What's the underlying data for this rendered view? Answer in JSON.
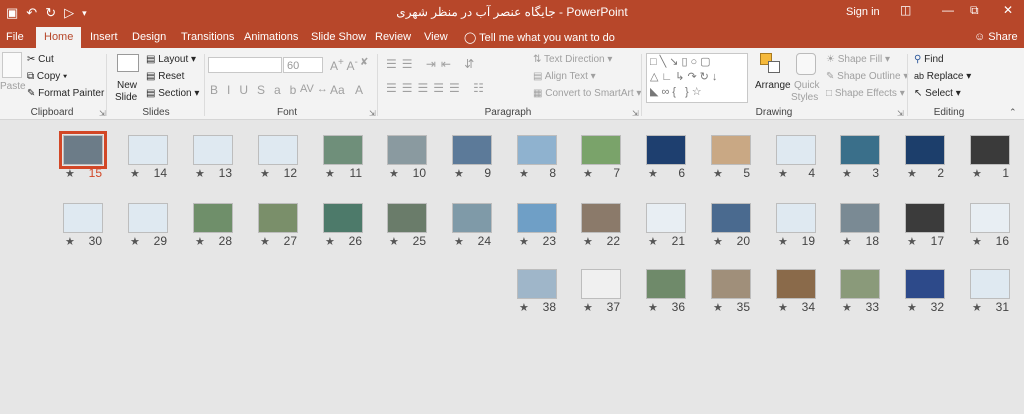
{
  "titlebar": {
    "title": "جایگاه عنصر آب در منظر شهری  -  PowerPoint",
    "sign_in": "Sign in",
    "minimize": "—"
  },
  "tabs": [
    "File",
    "Home",
    "Insert",
    "Design",
    "Transitions",
    "Animations",
    "Slide Show",
    "Review",
    "View"
  ],
  "tell_me": "Tell me what you want to do",
  "share": "Share",
  "ribbon": {
    "clipboard": {
      "paste": "Paste",
      "cut": "Cut",
      "copy": "Copy",
      "format_painter": "Format Painter",
      "label": "Clipboard"
    },
    "slides": {
      "new_slide_1": "New",
      "new_slide_2": "Slide",
      "layout": "Layout",
      "reset": "Reset",
      "section": "Section",
      "label": "Slides"
    },
    "font": {
      "size": "60",
      "label": "Font"
    },
    "paragraph": {
      "text_direction": "Text Direction",
      "align_text": "Align Text",
      "convert": "Convert to SmartArt",
      "label": "Paragraph"
    },
    "drawing": {
      "arrange": "Arrange",
      "quick_styles_1": "Quick",
      "quick_styles_2": "Styles",
      "shape_fill": "Shape Fill",
      "shape_outline": "Shape Outline",
      "shape_effects": "Shape Effects",
      "label": "Drawing"
    },
    "editing": {
      "find": "Find",
      "replace": "Replace",
      "select": "Select",
      "label": "Editing"
    }
  },
  "slides": [
    {
      "num": "1",
      "color": "#3a3a3a"
    },
    {
      "num": "2",
      "color": "#1c3e6b"
    },
    {
      "num": "3",
      "color": "#3a6f8a"
    },
    {
      "num": "4",
      "color": "#dfe9f1"
    },
    {
      "num": "5",
      "color": "#c9a884"
    },
    {
      "num": "6",
      "color": "#1e3f6f"
    },
    {
      "num": "7",
      "color": "#7aa36a"
    },
    {
      "num": "8",
      "color": "#8fb2cf"
    },
    {
      "num": "9",
      "color": "#5c7a99"
    },
    {
      "num": "10",
      "color": "#8a9aa0"
    },
    {
      "num": "11",
      "color": "#6f8f7a"
    },
    {
      "num": "12",
      "color": "#dfe9f1"
    },
    {
      "num": "13",
      "color": "#dfe9f1"
    },
    {
      "num": "14",
      "color": "#dfe9f1"
    },
    {
      "num": "15",
      "color": "#6c7c88"
    },
    {
      "num": "16",
      "color": "#e8eef3"
    },
    {
      "num": "17",
      "color": "#3b3b3b"
    },
    {
      "num": "18",
      "color": "#7a8a94"
    },
    {
      "num": "19",
      "color": "#dfe9f1"
    },
    {
      "num": "20",
      "color": "#4a6a8f"
    },
    {
      "num": "21",
      "color": "#e8eef3"
    },
    {
      "num": "22",
      "color": "#8b7a6a"
    },
    {
      "num": "23",
      "color": "#6f9fc6"
    },
    {
      "num": "24",
      "color": "#7f9aa8"
    },
    {
      "num": "25",
      "color": "#6a7c6a"
    },
    {
      "num": "26",
      "color": "#4d7a6a"
    },
    {
      "num": "27",
      "color": "#7a8f6a"
    },
    {
      "num": "28",
      "color": "#6f8f6a"
    },
    {
      "num": "29",
      "color": "#dfe9f1"
    },
    {
      "num": "30",
      "color": "#dfe9f1"
    },
    {
      "num": "31",
      "color": "#dfe9f1"
    },
    {
      "num": "32",
      "color": "#2d4a8a"
    },
    {
      "num": "33",
      "color": "#8a9a7a"
    },
    {
      "num": "34",
      "color": "#8a6a4a"
    },
    {
      "num": "35",
      "color": "#a08f7a"
    },
    {
      "num": "36",
      "color": "#6f8a6a"
    },
    {
      "num": "37",
      "color": "#f0f0f0"
    },
    {
      "num": "38",
      "color": "#9fb6c9"
    }
  ],
  "selected_slide": "15",
  "colors": {
    "accent": "#b7472a",
    "selection": "#d24726"
  }
}
